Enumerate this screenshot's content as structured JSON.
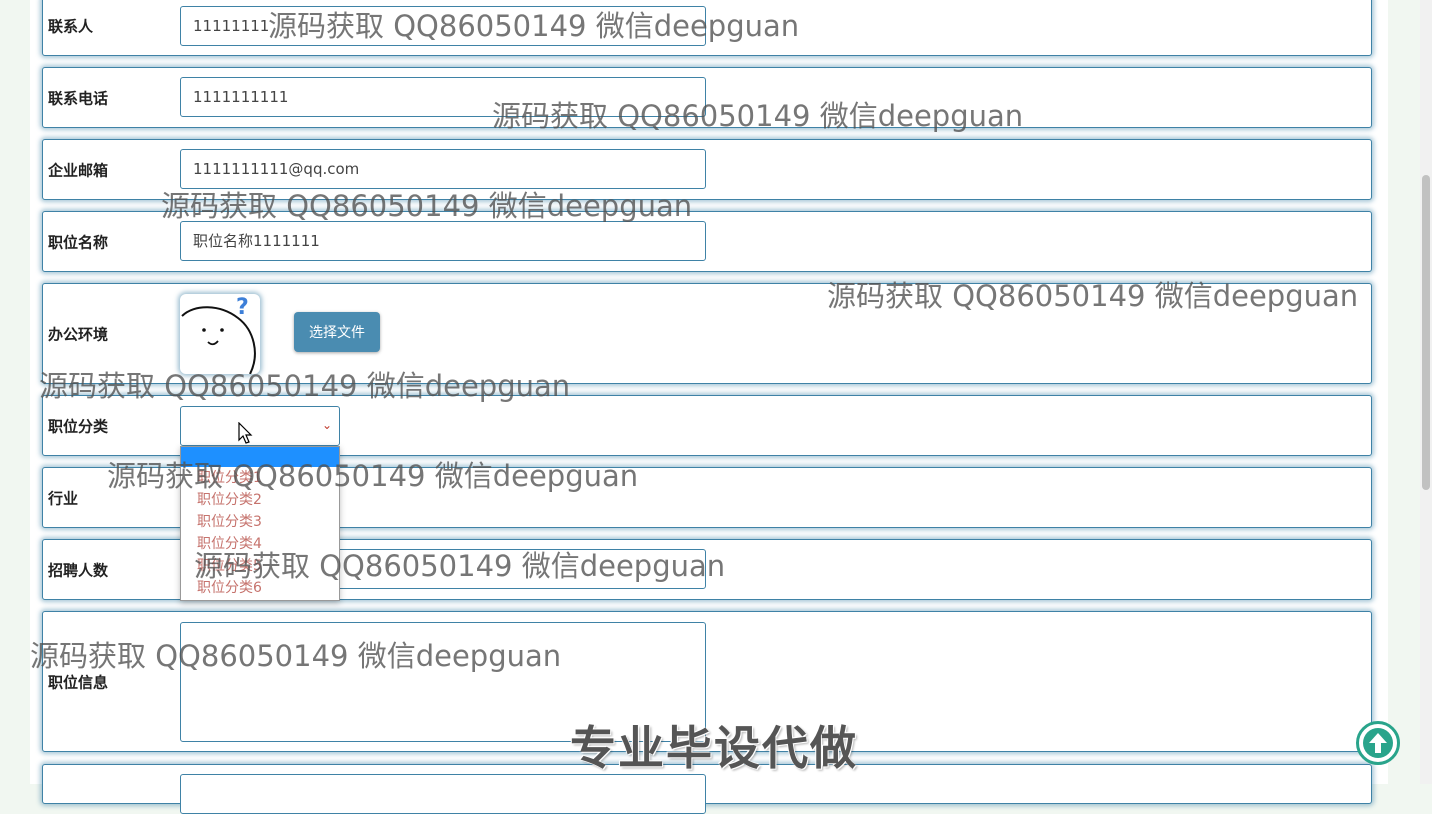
{
  "form": {
    "contact": {
      "label": "联系人",
      "value": "11111111"
    },
    "phone": {
      "label": "联系电话",
      "value": "1111111111"
    },
    "email": {
      "label": "企业邮箱",
      "value": "1111111111@qq.com"
    },
    "job_name": {
      "label": "职位名称",
      "value": "职位名称1111111"
    },
    "office": {
      "label": "办公环境",
      "file_button": "选择文件"
    },
    "category": {
      "label": "职位分类",
      "selected": "",
      "options": [
        "职位分类1",
        "职位分类2",
        "职位分类3",
        "职位分类4",
        "职位分类5",
        "职位分类6"
      ]
    },
    "industry": {
      "label": "行业"
    },
    "headcount": {
      "label": "招聘人数"
    },
    "job_info": {
      "label": "职位信息"
    }
  },
  "overlay": {
    "watermark": "源码获取 QQ86050149 微信deepguan",
    "promo": "专业毕设代做"
  },
  "colors": {
    "accent": "#3f82a6",
    "button": "#4a8cb1",
    "dropdown_highlight": "#1e90ff",
    "option_text": "#c6736d",
    "back_to_top": "#29a48b"
  }
}
